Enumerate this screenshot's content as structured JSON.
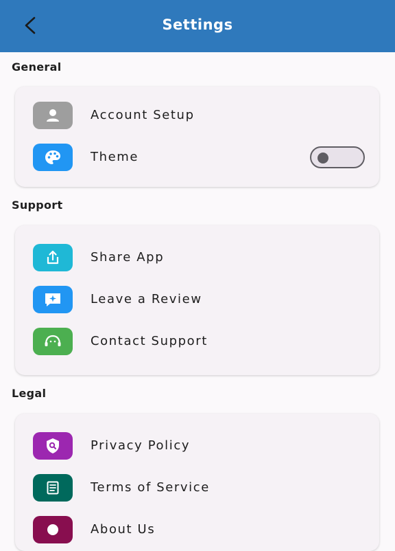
{
  "header": {
    "title": "Settings",
    "back_icon": "chevron-left-icon",
    "background": "#2f79bc"
  },
  "sections": [
    {
      "title": "General",
      "items": [
        {
          "label": "Account Setup",
          "icon": "person-icon",
          "color": "#9e9e9e"
        },
        {
          "label": "Theme",
          "icon": "palette-icon",
          "color": "#2196f3",
          "toggle": false
        }
      ]
    },
    {
      "title": "Support",
      "items": [
        {
          "label": "Share App",
          "icon": "share-icon",
          "color": "#1fb8d6"
        },
        {
          "label": "Leave a Review",
          "icon": "review-icon",
          "color": "#2196f3"
        },
        {
          "label": "Contact Support",
          "icon": "support-agent-icon",
          "color": "#4caf50"
        }
      ]
    },
    {
      "title": "Legal",
      "items": [
        {
          "label": "Privacy Policy",
          "icon": "privacy-shield-icon",
          "color": "#9c27b0"
        },
        {
          "label": "Terms of Service",
          "icon": "document-icon",
          "color": "#00695c"
        },
        {
          "label": "About Us",
          "icon": "info-icon",
          "color": "#880e4f"
        }
      ]
    }
  ]
}
